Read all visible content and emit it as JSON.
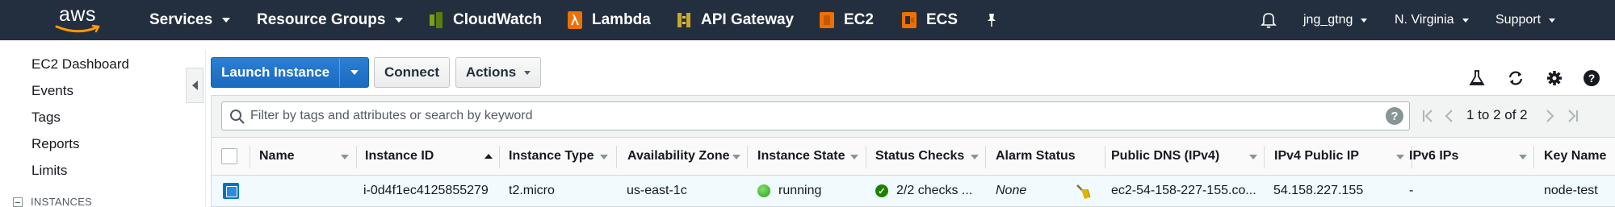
{
  "topnav": {
    "logo_text": "aws",
    "items": [
      {
        "label": "Services",
        "dropdown": true
      },
      {
        "label": "Resource Groups",
        "dropdown": true
      },
      {
        "label": "CloudWatch",
        "icon": "cloudwatch-icon",
        "color": "#7aa116"
      },
      {
        "label": "Lambda",
        "icon": "lambda-icon",
        "color": "#ed7100"
      },
      {
        "label": "API Gateway",
        "icon": "api-gateway-icon",
        "color": "#e7157b"
      },
      {
        "label": "EC2",
        "icon": "ec2-icon",
        "color": "#ed7100"
      },
      {
        "label": "ECS",
        "icon": "ecs-icon",
        "color": "#ed7100"
      }
    ],
    "user": "jng_gtng",
    "region": "N. Virginia",
    "support": "Support"
  },
  "sidebar": {
    "items": [
      "EC2 Dashboard",
      "Events",
      "Tags",
      "Reports",
      "Limits"
    ],
    "section": "INSTANCES"
  },
  "toolbar": {
    "launch_label": "Launch Instance",
    "connect_label": "Connect",
    "actions_label": "Actions"
  },
  "search": {
    "placeholder": "Filter by tags and attributes or search by keyword",
    "value": ""
  },
  "pager": {
    "text": "1 to 2 of 2"
  },
  "table": {
    "columns": [
      "Name",
      "Instance ID",
      "Instance Type",
      "Availability Zone",
      "Instance State",
      "Status Checks",
      "Alarm Status",
      "Public DNS (IPv4)",
      "IPv4 Public IP",
      "IPv6 IPs",
      "Key Name"
    ],
    "rows": [
      {
        "name": "",
        "instance_id": "i-0d4f1ec4125855279",
        "instance_type": "t2.micro",
        "availability_zone": "us-east-1c",
        "instance_state": "running",
        "status_checks": "2/2 checks ...",
        "alarm_status": "None",
        "public_dns": "ec2-54-158-227-155.co...",
        "ipv4_public_ip": "54.158.227.155",
        "ipv6_ips": "-",
        "key_name": "node-test"
      }
    ]
  },
  "colors": {
    "nav_bg": "#232f3e",
    "primary_button": "#1b6abf",
    "running": "#3cb521",
    "row_selected_bg": "#f1faff"
  }
}
